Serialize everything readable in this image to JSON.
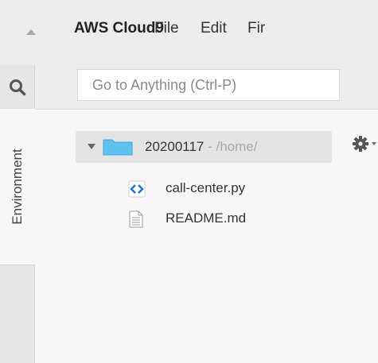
{
  "menubar": {
    "brand": "AWS Cloud9",
    "items": [
      "File",
      "Edit",
      "Fir"
    ]
  },
  "search": {
    "placeholder": "Go to Anything (Ctrl-P)"
  },
  "rail": {
    "tab_label": "Environment"
  },
  "tree": {
    "root": {
      "name": "20200117",
      "path": " - /home/"
    },
    "files": [
      {
        "name": "call-center.py",
        "icon": "python-file-icon"
      },
      {
        "name": "README.md",
        "icon": "text-file-icon"
      }
    ]
  },
  "colors": {
    "folder": "#5cc3f0",
    "code_icon": "#1f73d6"
  }
}
